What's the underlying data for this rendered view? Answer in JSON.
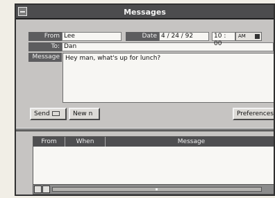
{
  "window": {
    "title": "Messages"
  },
  "compose": {
    "from_label": "From",
    "from_value": "Lee",
    "to_label": "To:",
    "to_value": "Dan",
    "message_label": "Message",
    "message_value": "Hey man, what's up for lunch?",
    "date_label": "Date",
    "date_value": "4  / 24 / 92",
    "time_value": "10 : 00",
    "ampm_value": "AM"
  },
  "buttons": {
    "send_label": "Send",
    "new_label": "New",
    "new_cursor": "n",
    "preferences_label": "Preferences"
  },
  "list": {
    "columns": [
      "From",
      "When",
      "Message"
    ]
  }
}
